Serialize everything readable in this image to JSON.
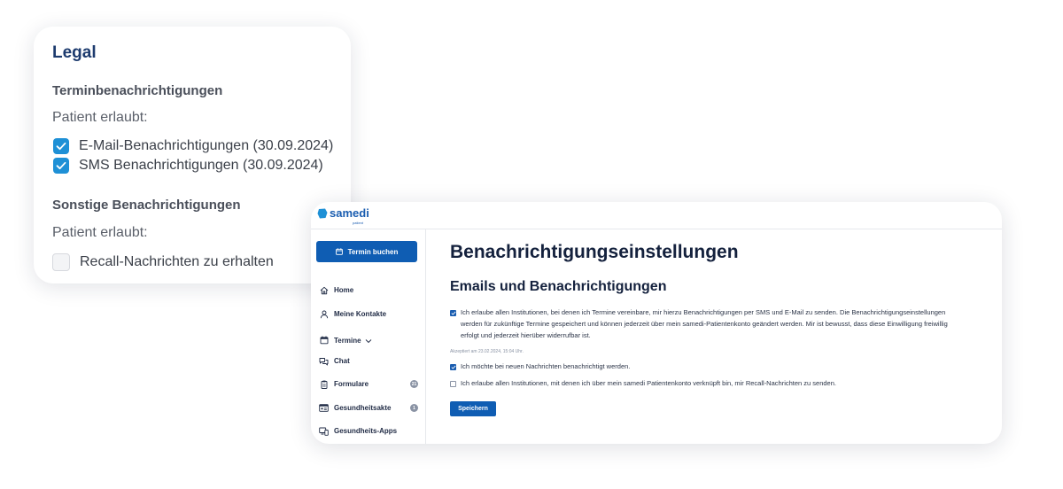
{
  "legal": {
    "title": "Legal",
    "appointment_section": "Terminbenachrichtigungen",
    "patient_allowed_1": "Patient erlaubt:",
    "items": [
      {
        "label": "E-Mail-Benachrichtigungen (30.09.2024)",
        "checked": true
      },
      {
        "label": "SMS Benachrichtigungen (30.09.2024)",
        "checked": true
      }
    ],
    "other_section": "Sonstige Benachrichtigungen",
    "patient_allowed_2": "Patient erlaubt:",
    "recall": {
      "label": "Recall-Nachrichten zu erhalten",
      "checked": false
    }
  },
  "app": {
    "logo": {
      "word": "samedi",
      "sub": "patient",
      "icon": "samedi-logo-icon"
    },
    "book_button": "Termin buchen",
    "nav": [
      {
        "label": "Home",
        "icon": "home-icon"
      },
      {
        "label": "Meine Kontakte",
        "icon": "person-icon"
      },
      {
        "label": "Termine",
        "icon": "calendar-icon",
        "expandable": true
      },
      {
        "label": "Chat",
        "icon": "chat-icon"
      },
      {
        "label": "Formulare",
        "icon": "clipboard-icon",
        "badge": "21"
      },
      {
        "label": "Gesundheitsakte",
        "icon": "id-card-icon",
        "badge": "1"
      },
      {
        "label": "Gesundheits-Apps",
        "icon": "devices-icon"
      }
    ],
    "page_title": "Benachrichtigungseinstellungen",
    "section_title": "Emails und Benachrichtigungen",
    "consents": [
      {
        "text": "Ich erlaube allen Institutionen, bei denen ich Termine vereinbare, mir hierzu Benachrichtigungen per SMS und E-Mail zu senden. Die Benachrichtigungseinstellungen werden für zukünftige Termine gespeichert und können jederzeit über mein samedi-Patientenkonto geändert werden. Mir ist bewusst, dass diese Einwilligung freiwillig erfolgt und jederzeit hierüber widerrufbar ist.",
        "checked": true
      },
      {
        "text": "Ich möchte bei neuen Nachrichten benachrichtigt werden.",
        "checked": true
      },
      {
        "text": "Ich erlaube allen Institutionen, mit denen ich über mein samedi Patientenkonto verknüpft bin, mir Recall-Nachrichten zu senden.",
        "checked": false
      }
    ],
    "accepted_note": "Akzeptiert am 23.02.2024, 15:04 Uhr.",
    "save_button": "Speichern",
    "colors": {
      "primary": "#0f5db3",
      "check": "#1e90d6"
    }
  }
}
